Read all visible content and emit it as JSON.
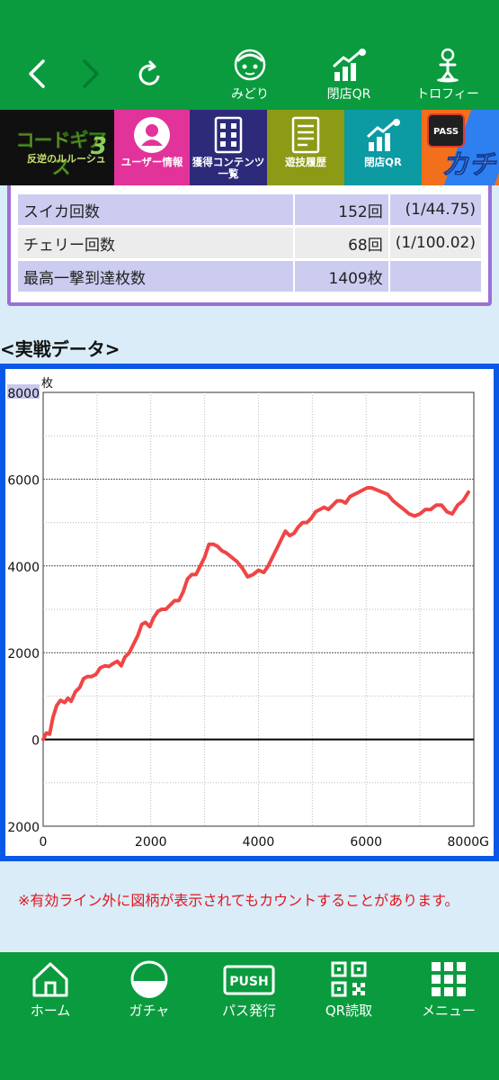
{
  "top_nav": {
    "midori_label": "みどり",
    "heiten_qr_label": "閉店QR",
    "trophy_label": "トロフィー"
  },
  "strip": {
    "logo_title": "コードギアス",
    "logo_subtitle": "反逆のルルーシュ",
    "logo_number": "3",
    "user_info_label": "ユーザー情報",
    "content_list_label": "獲得コンテンツ一覧",
    "history_label": "遊技履歴",
    "heiten_qr_label": "閉店QR",
    "pass_label": "PASS",
    "kachi_label": "カチ"
  },
  "stats": {
    "rows": [
      {
        "label": "スイカ回数",
        "value": "152回",
        "rate": "(1/44.75)"
      },
      {
        "label": "チェリー回数",
        "value": "68回",
        "rate": "(1/100.02)"
      },
      {
        "label": "最高一撃到達枚数",
        "value": "1409枚",
        "rate": ""
      }
    ]
  },
  "section_title": "<実戦データ>",
  "chart_data": {
    "type": "line",
    "ylabel": "枚",
    "xlabel": "",
    "x_unit_suffix": "G",
    "xlim": [
      0,
      8000
    ],
    "ylim": [
      -2000,
      8000
    ],
    "x_ticks": [
      "0",
      "2000",
      "4000",
      "6000",
      "8000G"
    ],
    "y_ticks": [
      "8000",
      "6000",
      "4000",
      "2000",
      "0",
      "2000"
    ],
    "grid": true,
    "line_color": "#f04545",
    "series": [
      {
        "x": [
          0,
          60,
          120,
          180,
          250,
          320,
          400,
          460,
          520,
          600,
          680,
          750,
          820,
          900,
          980,
          1060,
          1150,
          1220,
          1300,
          1380,
          1450,
          1520,
          1600,
          1680,
          1760,
          1830,
          1900,
          1980,
          2050,
          2130,
          2200,
          2280,
          2360,
          2440,
          2520,
          2600,
          2680,
          2760,
          2840,
          2920,
          3000,
          3080,
          3160,
          3240,
          3320,
          3400,
          3500,
          3600,
          3700,
          3800,
          3900,
          4000,
          4100,
          4180,
          4260,
          4340,
          4420,
          4500,
          4580,
          4660,
          4740,
          4820,
          4900,
          4980,
          5060,
          5140,
          5220,
          5300,
          5380,
          5460,
          5540,
          5620,
          5700,
          5780,
          5860,
          5940,
          6020,
          6100,
          6200,
          6300,
          6400,
          6500,
          6600,
          6700,
          6800,
          6900,
          7000,
          7100,
          7200,
          7300,
          7400,
          7500,
          7600,
          7700,
          7800,
          7900
        ],
        "y": [
          0,
          150,
          120,
          500,
          780,
          900,
          850,
          950,
          880,
          1100,
          1200,
          1400,
          1450,
          1450,
          1500,
          1650,
          1700,
          1680,
          1750,
          1800,
          1700,
          1900,
          2000,
          2200,
          2400,
          2650,
          2700,
          2600,
          2800,
          2950,
          3000,
          3000,
          3100,
          3200,
          3200,
          3400,
          3700,
          3800,
          3800,
          4000,
          4200,
          4500,
          4500,
          4450,
          4350,
          4300,
          4200,
          4100,
          3950,
          3750,
          3800,
          3900,
          3850,
          4000,
          4200,
          4400,
          4600,
          4800,
          4700,
          4750,
          4900,
          5000,
          5000,
          5100,
          5250,
          5300,
          5350,
          5300,
          5400,
          5500,
          5500,
          5450,
          5600,
          5650,
          5700,
          5750,
          5800,
          5800,
          5750,
          5700,
          5650,
          5500,
          5400,
          5300,
          5200,
          5150,
          5200,
          5300,
          5300,
          5400,
          5400,
          5250,
          5200,
          5400,
          5500,
          5700
        ]
      }
    ]
  },
  "note_text": "※有効ライン外に図柄が表示されてもカウントすることがあります。",
  "bottom_nav": {
    "home_label": "ホーム",
    "gacha_label": "ガチャ",
    "pass_issue_label": "パス発行",
    "push_label": "PUSH",
    "qr_read_label": "QR読取",
    "menu_label": "メニュー"
  },
  "colors": {
    "app_green": "#0a9b3e",
    "chart_border": "#0a58e8",
    "stats_border": "#9c6fd7",
    "note_red": "#e0161f"
  }
}
